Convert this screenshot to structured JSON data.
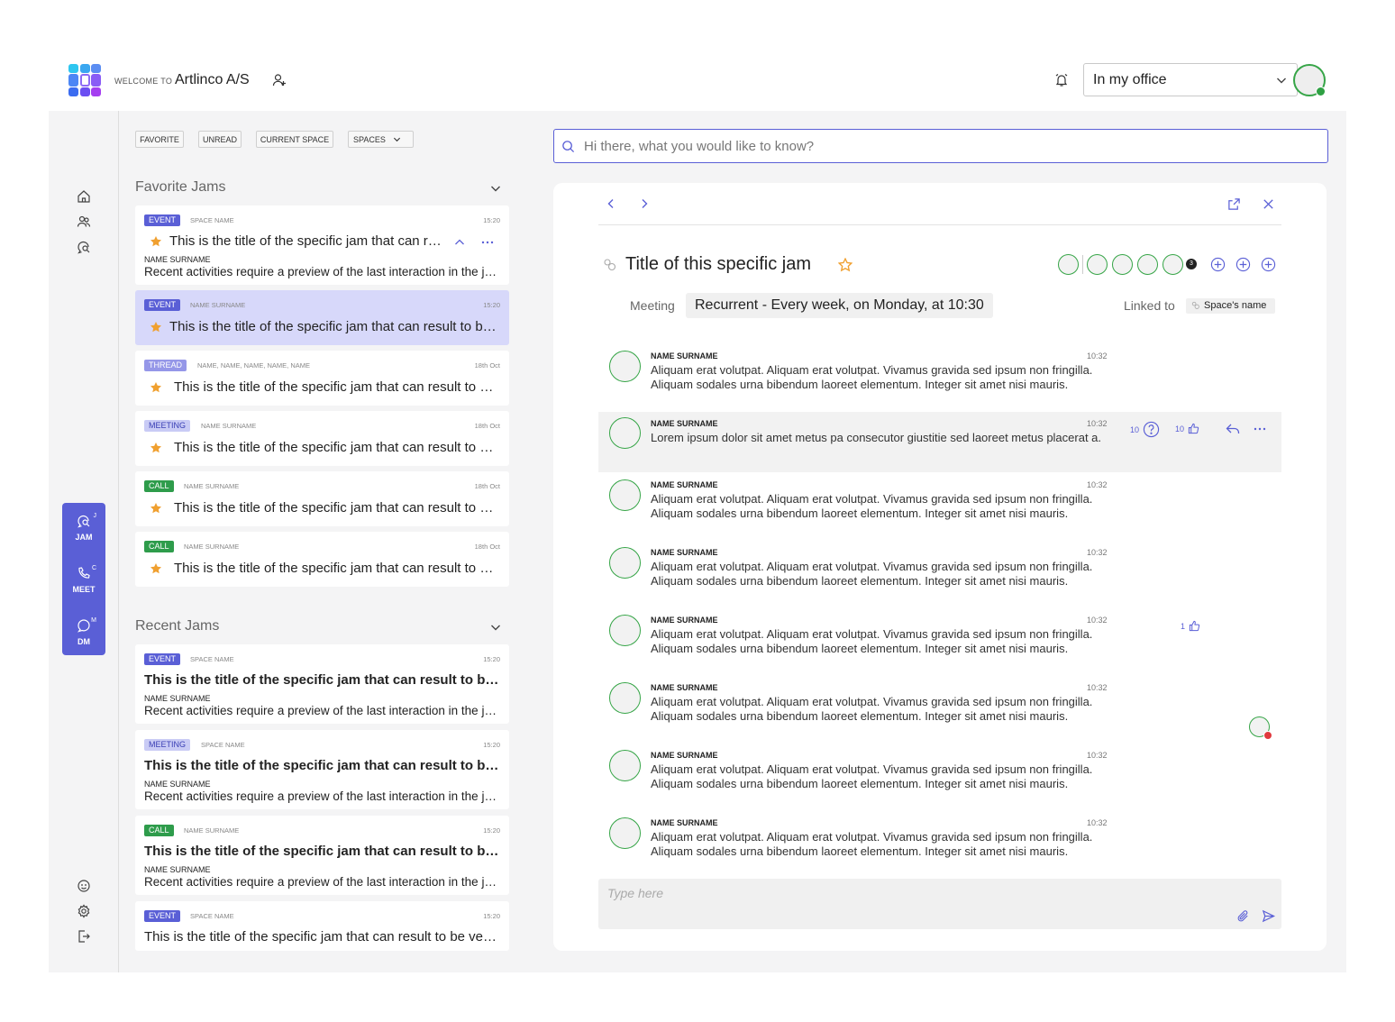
{
  "header": {
    "welcome_small": "WELCOME TO",
    "company": "Artlinco A/S",
    "status_value": "In my office",
    "logo_colors": [
      "#2ec6f0",
      "#3aa7f0",
      "#5b8df2",
      "#4c86f5",
      "#ffffff",
      "#8a5cf5",
      "#3b6cf0",
      "#6b4ef2",
      "#a43ef0"
    ]
  },
  "modes": [
    {
      "label": "JAM",
      "key": "J"
    },
    {
      "label": "MEET",
      "key": "C"
    },
    {
      "label": "DM",
      "key": "M"
    }
  ],
  "filters": {
    "favorite": "FAVORITE",
    "unread": "UNREAD",
    "current_space": "CURRENT SPACE",
    "spaces": "SPACES"
  },
  "favorite_section": {
    "title": "Favorite Jams"
  },
  "recent_section": {
    "title": "Recent Jams"
  },
  "favorite_jams": [
    {
      "tag": "EVENT",
      "meta": "SPACE NAME",
      "time": "15:20",
      "title": "This is the title of the specific jam that can result to be very long",
      "name": "NAME SURNAME",
      "preview": "Recent activities require a preview of the last interaction in the jam to be displayed here"
    },
    {
      "tag": "EVENT",
      "meta": "NAME SURNAME",
      "time": "15:20",
      "title": "This is the title of the specific jam that can result to be very long"
    },
    {
      "tag": "THREAD",
      "meta": "NAME, NAME, NAME, NAME, NAME",
      "time": "18th Oct",
      "title": "This is the title of the specific jam that can result to be very long"
    },
    {
      "tag": "MEETING",
      "meta": "NAME SURNAME",
      "time": "18th Oct",
      "title": "This is the title of the specific jam that can result to be very long"
    },
    {
      "tag": "CALL",
      "meta": "NAME SURNAME",
      "time": "18th Oct",
      "title": "This is the title of the specific jam that can result to be very long"
    },
    {
      "tag": "CALL",
      "meta": "NAME SURNAME",
      "time": "18th Oct",
      "title": "This is the title of the specific jam that can result to be very long"
    }
  ],
  "recent_jams": [
    {
      "tag": "EVENT",
      "meta": "SPACE NAME",
      "time": "15:20",
      "title": "This is the title of the specific jam that can result to be very long",
      "name": "NAME SURNAME",
      "preview": "Recent activities require a preview of the last interaction in the jam to be displayed here"
    },
    {
      "tag": "MEETING",
      "meta": "SPACE NAME",
      "time": "15:20",
      "title": "This is the title of the specific jam that can result to be very long",
      "name": "NAME SURNAME",
      "preview": "Recent activities require a preview of the last interaction in the jam to be displayed here"
    },
    {
      "tag": "CALL",
      "meta": "NAME SURNAME",
      "time": "15:20",
      "title": "This is the title of the specific jam that can result to be very long",
      "name": "NAME SURNAME",
      "preview": "Recent activities require a preview of the last interaction in the jam to be displayed here"
    },
    {
      "tag": "EVENT",
      "meta": "SPACE NAME",
      "time": "15:20",
      "title": "This is the title of the specific jam that can result to be very long"
    }
  ],
  "search": {
    "placeholder": "Hi there, what you would like to know?"
  },
  "jam": {
    "title": "Title of this specific jam",
    "participant_overflow": "3",
    "meeting_label": "Meeting",
    "recurrence": "Recurrent - Every week, on Monday, at 10:30",
    "linked_label": "Linked to",
    "space_name": "Space's name"
  },
  "messages": [
    {
      "name": "NAME SURNAME",
      "time": "10:32",
      "text": "Aliquam erat volutpat. Aliquam erat volutpat. Vivamus gravida sed ipsum non fringilla. Aliquam sodales urna bibendum laoreet elementum. Integer sit amet nisi mauris."
    },
    {
      "name": "NAME SURNAME",
      "time": "10:32",
      "text": "Lorem ipsum dolor sit amet metus pa consecutor giustitie sed laoreet metus placerat a.",
      "questions": "10",
      "likes": "10"
    },
    {
      "name": "NAME SURNAME",
      "time": "10:32",
      "text": "Aliquam erat volutpat. Aliquam erat volutpat. Vivamus gravida sed ipsum non fringilla. Aliquam sodales urna bibendum laoreet elementum. Integer sit amet nisi mauris."
    },
    {
      "name": "NAME SURNAME",
      "time": "10:32",
      "text": "Aliquam erat volutpat. Aliquam erat volutpat. Vivamus gravida sed ipsum non fringilla. Aliquam sodales urna bibendum laoreet elementum. Integer sit amet nisi mauris."
    },
    {
      "name": "NAME SURNAME",
      "time": "10:32",
      "text": "Aliquam erat volutpat. Aliquam erat volutpat. Vivamus gravida sed ipsum non fringilla. Aliquam sodales urna bibendum laoreet elementum. Integer sit amet nisi mauris.",
      "likes": "1"
    },
    {
      "name": "NAME SURNAME",
      "time": "10:32",
      "text": "Aliquam erat volutpat. Aliquam erat volutpat. Vivamus gravida sed ipsum non fringilla. Aliquam sodales urna bibendum laoreet elementum. Integer sit amet nisi mauris."
    },
    {
      "name": "NAME SURNAME",
      "time": "10:32",
      "text": "Aliquam erat volutpat. Aliquam erat volutpat. Vivamus gravida sed ipsum non fringilla. Aliquam sodales urna bibendum laoreet elementum. Integer sit amet nisi mauris."
    },
    {
      "name": "NAME SURNAME",
      "time": "10:32",
      "text": "Aliquam erat volutpat. Aliquam erat volutpat. Vivamus gravida sed ipsum non fringilla. Aliquam sodales urna bibendum laoreet elementum. Integer sit amet nisi mauris."
    }
  ],
  "composer": {
    "placeholder": "Type here"
  },
  "colors": {
    "accent": "#5a5fd6",
    "online": "#2ea043",
    "star": "#f0a030",
    "offline_badge": "#e0393e"
  },
  "icons": [
    "add-user-icon",
    "alarm-icon",
    "chevron-down-icon",
    "home-icon",
    "people-icon",
    "chat-search-icon",
    "emoji-icon",
    "settings-icon",
    "logout-icon",
    "search-icon",
    "chevron-left-icon",
    "chevron-right-icon",
    "open-external-icon",
    "close-icon",
    "star-icon",
    "plus-circle-icon",
    "question-icon",
    "thumbs-up-icon",
    "reply-icon",
    "more-icon",
    "attach-icon",
    "send-icon"
  ]
}
